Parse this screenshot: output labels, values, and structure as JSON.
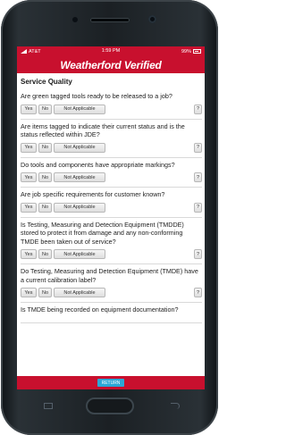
{
  "status": {
    "carrier": "AT&T",
    "time": "1:59 PM",
    "battery": "99%"
  },
  "brand": "Weatherford Verified",
  "section_title": "Service Quality",
  "buttons": {
    "yes": "Yes",
    "no": "No",
    "na": "Not Applicable",
    "help": "?"
  },
  "questions": [
    "Are green tagged tools ready to be released to a job?",
    "Are items tagged to indicate their current status and is the status reflected within JDE?",
    "Do tools and components have appropriate markings?",
    "Are job specific requirements for customer known?",
    "Is Testing, Measuring and Detection Equipment (TMDDE) stored to protect it from damage and any non-conforming TMDE been taken out of service?",
    "Do Testing, Measuring and Detection Equipment (TMDE) have a current calibration label?",
    "Is TMDE being recorded on equipment documentation?"
  ],
  "footer": {
    "return_label": "RETURN"
  },
  "colors": {
    "brand_red": "#c8102e",
    "return_blue": "#2aa8d6"
  }
}
